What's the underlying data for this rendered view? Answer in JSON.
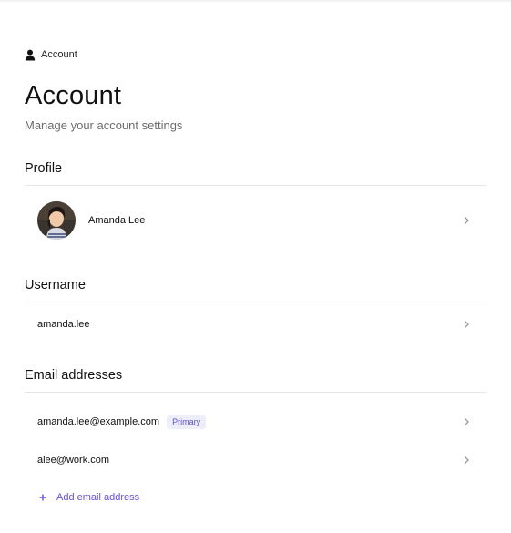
{
  "breadcrumb": {
    "label": "Account",
    "icon": "user-icon"
  },
  "header": {
    "title": "Account",
    "subtitle": "Manage your account settings"
  },
  "profile": {
    "section_title": "Profile",
    "name": "Amanda Lee",
    "avatar_icon": "avatar-photo"
  },
  "username": {
    "section_title": "Username",
    "value": "amanda.lee"
  },
  "emails": {
    "section_title": "Email addresses",
    "items": [
      {
        "address": "amanda.lee@example.com",
        "badge": "Primary"
      },
      {
        "address": "alee@work.com",
        "badge": ""
      }
    ],
    "add_label": "Add email address"
  },
  "colors": {
    "accent": "#6a4ee6",
    "badge_bg": "#eeeefb",
    "divider": "#e6e6e6",
    "muted_text": "#6b6b6b"
  }
}
